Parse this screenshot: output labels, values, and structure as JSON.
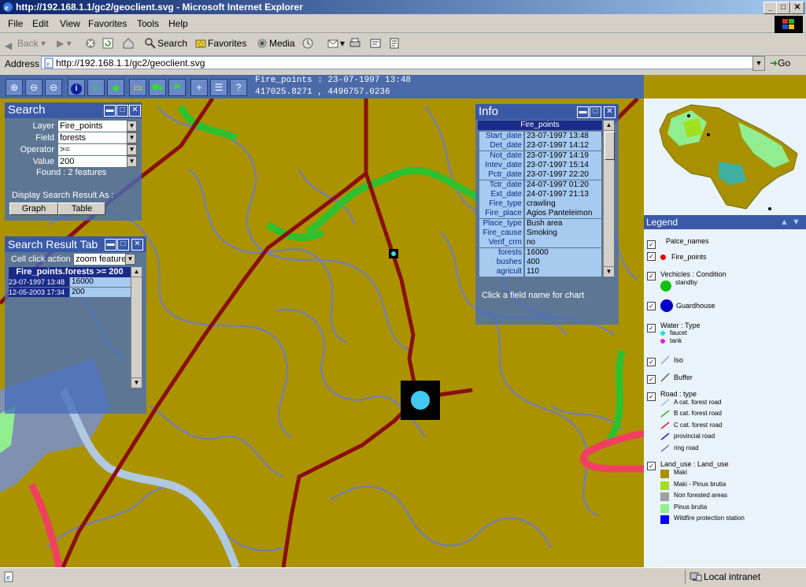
{
  "window": {
    "title": "http://192.168.1.1/gc2/geoclient.svg - Microsoft Internet Explorer",
    "min": "_",
    "max": "□",
    "close": "✕"
  },
  "menu": [
    "File",
    "Edit",
    "View",
    "Favorites",
    "Tools",
    "Help"
  ],
  "toolbar": {
    "back": "Back",
    "search": "Search",
    "favorites": "Favorites",
    "media": "Media"
  },
  "address": {
    "label": "Address",
    "url": "http://192.168.1.1/gc2/geoclient.svg",
    "go": "Go"
  },
  "map_toolbar": {
    "buttons": [
      "zoom-in",
      "zoom-out",
      "zoom-previous",
      "info",
      "measure",
      "layers",
      "label",
      "vehicle",
      "pan",
      "add-point",
      "list",
      "help"
    ],
    "info_line1": "Fire_points : 23-07-1997 13:48",
    "info_line2": "417025.8271 , 4496757.0236"
  },
  "search_panel": {
    "title": "Search",
    "layer_label": "Layer",
    "layer_value": "Fire_points",
    "field_label": "Field",
    "field_value": "forests",
    "operator_label": "Operator",
    "operator_value": ">=",
    "value_label": "Value",
    "value_value": "200",
    "found": "Found : 2 features",
    "display_as": "Display Search Result As :",
    "graph_button": "Graph",
    "table_button": "Table"
  },
  "result_panel": {
    "title": "Search Result Tab",
    "cell_click_label": "Cell click action",
    "cell_click_value": "zoom feature",
    "table_header": "Fire_points.forests >= 200",
    "rows": [
      {
        "date": "23-07-1997 13:48",
        "value": "16000"
      },
      {
        "date": "12-05-2003 17:34",
        "value": "200"
      }
    ]
  },
  "info_panel": {
    "title": "Info",
    "header": "Fire_points",
    "rows": [
      {
        "key": "Start_date",
        "value": "23-07-1997 13:48"
      },
      {
        "key": "Det_date",
        "value": "23-07-1997 14:12"
      },
      {
        "key": "Not_date",
        "value": "23-07-1997 14:19"
      },
      {
        "key": "Intev_date",
        "value": "23-07-1997 15:14"
      },
      {
        "key": "Pctr_date",
        "value": "23-07-1997 22:20"
      },
      {
        "key": "Tctr_date",
        "value": "24-07-1997 01:20"
      },
      {
        "key": "Ext_date",
        "value": "24-07-1997 21:13"
      },
      {
        "key": "Fire_type",
        "value": "crawling"
      },
      {
        "key": "Fire_place",
        "value": "Agios Panteleimon"
      },
      {
        "key": "Place_type",
        "value": "Bush area"
      },
      {
        "key": "Fire_cause",
        "value": "Smoking"
      },
      {
        "key": "Verif_crm",
        "value": "no"
      },
      {
        "key": "forests",
        "value": "16000"
      },
      {
        "key": "bushes",
        "value": "400"
      },
      {
        "key": "agricult",
        "value": "110"
      }
    ],
    "hint": "Click a field name for chart"
  },
  "legend": {
    "title": "Legend",
    "items": [
      {
        "label": "Palce_names",
        "checked": true
      },
      {
        "label": "Fire_points",
        "checked": true,
        "color": "#e00000"
      },
      {
        "label": "Vechicles : Condition",
        "checked": true,
        "sub": [
          "standby"
        ],
        "sub_colors": [
          "#10c010"
        ]
      },
      {
        "label": "Guardhouse",
        "checked": true,
        "color": "#0000c8"
      },
      {
        "label": "Water : Type",
        "checked": true,
        "sub": [
          "faucet",
          "tank"
        ],
        "sub_colors": [
          "#20e0e0",
          "#e020e0"
        ]
      },
      {
        "label": "Iso",
        "checked": true
      },
      {
        "label": "Buffer",
        "checked": true
      },
      {
        "label": "Road : type",
        "checked": true,
        "sub": [
          "A cat. forest road",
          "B cat. forest road",
          "C cat. forest road",
          "provincial road",
          "ring road"
        ],
        "sub_colors": [
          "#a0c0e0",
          "#20c020",
          "#e02020",
          "#2020c0",
          "#808080"
        ]
      },
      {
        "label": "Land_use : Land_use",
        "checked": true,
        "sub": [
          "Maki",
          "Maki - Pinus brutia",
          "Non forested areas",
          "Pinus brutia",
          "Wildfire protection station"
        ],
        "sub_colors": [
          "#a89000",
          "#a0e020",
          "#a0a0a0",
          "#90ee90",
          "#0000ff"
        ]
      }
    ]
  },
  "status": {
    "zone": "Local intranet"
  }
}
